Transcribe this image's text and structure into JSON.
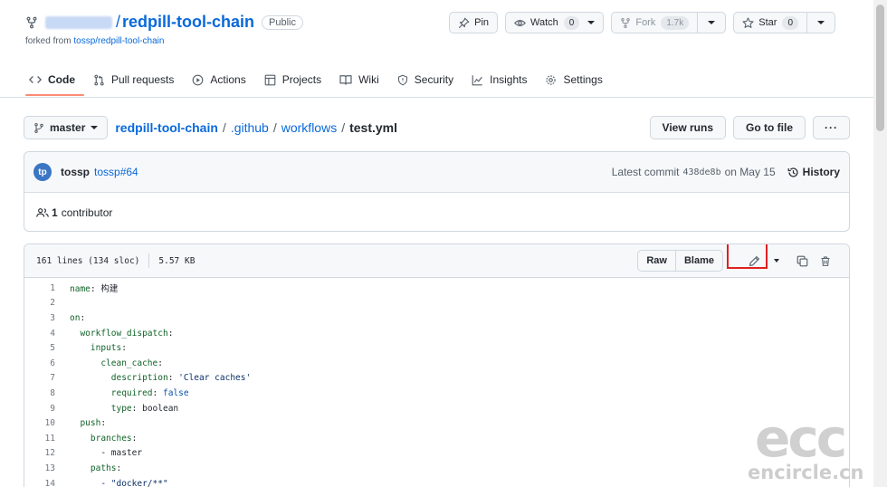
{
  "repo": {
    "name": "redpill-tool-chain",
    "visibility": "Public",
    "forked_from_prefix": "forked from",
    "forked_from": "tossp/redpill-tool-chain"
  },
  "actions": {
    "pin": "Pin",
    "watch": "Watch",
    "watch_count": "0",
    "fork": "Fork",
    "fork_count": "1.7k",
    "star": "Star",
    "star_count": "0"
  },
  "tabs": [
    {
      "label": "Code",
      "icon": "code-icon",
      "selected": true
    },
    {
      "label": "Pull requests",
      "icon": "pull-request-icon"
    },
    {
      "label": "Actions",
      "icon": "play-icon"
    },
    {
      "label": "Projects",
      "icon": "table-icon"
    },
    {
      "label": "Wiki",
      "icon": "book-icon"
    },
    {
      "label": "Security",
      "icon": "shield-icon"
    },
    {
      "label": "Insights",
      "icon": "graph-icon"
    },
    {
      "label": "Settings",
      "icon": "gear-icon"
    }
  ],
  "breadcrumb": {
    "branch": "master",
    "repo": "redpill-tool-chain",
    "dir1": ".github",
    "dir2": "workflows",
    "file": "test.yml",
    "sep": "/",
    "view_runs": "View runs",
    "go_to_file": "Go to file",
    "more": "···"
  },
  "commit": {
    "avatar_text": "tp",
    "author": "tossp",
    "message": "tossp#64",
    "latest_label": "Latest commit",
    "sha": "438de8b",
    "date": "on May 15",
    "history": "History",
    "contributors_count": "1",
    "contributors_label": "contributor"
  },
  "file": {
    "lines": "161 lines (134 sloc)",
    "size": "5.57 KB",
    "raw": "Raw",
    "blame": "Blame"
  },
  "code_lines": [
    {
      "n": "1",
      "indent": "",
      "key": "name",
      "value": "构建",
      "type": "plain"
    },
    {
      "n": "2",
      "indent": "",
      "key": "",
      "value": "",
      "type": "plain"
    },
    {
      "n": "3",
      "indent": "",
      "key": "on",
      "value": "",
      "type": "plain"
    },
    {
      "n": "4",
      "indent": "  ",
      "key": "workflow_dispatch",
      "value": "",
      "type": "plain"
    },
    {
      "n": "5",
      "indent": "    ",
      "key": "inputs",
      "value": "",
      "type": "plain"
    },
    {
      "n": "6",
      "indent": "      ",
      "key": "clean_cache",
      "value": "",
      "type": "plain"
    },
    {
      "n": "7",
      "indent": "        ",
      "key": "description",
      "value": "'Clear caches'",
      "type": "str"
    },
    {
      "n": "8",
      "indent": "        ",
      "key": "required",
      "value": "false",
      "type": "bool"
    },
    {
      "n": "9",
      "indent": "        ",
      "key": "type",
      "value": "boolean",
      "type": "plain"
    },
    {
      "n": "10",
      "indent": "  ",
      "key": "push",
      "value": "",
      "type": "plain"
    },
    {
      "n": "11",
      "indent": "    ",
      "key": "branches",
      "value": "",
      "type": "plain"
    },
    {
      "n": "12",
      "indent": "      ",
      "key": "",
      "value": "- master",
      "type": "item"
    },
    {
      "n": "13",
      "indent": "    ",
      "key": "paths",
      "value": "",
      "type": "plain"
    },
    {
      "n": "14",
      "indent": "      ",
      "key": "",
      "value": "- \"docker/**\"",
      "type": "item-str"
    }
  ],
  "watermark": {
    "big": "ecc",
    "small": "encircle.cn"
  }
}
